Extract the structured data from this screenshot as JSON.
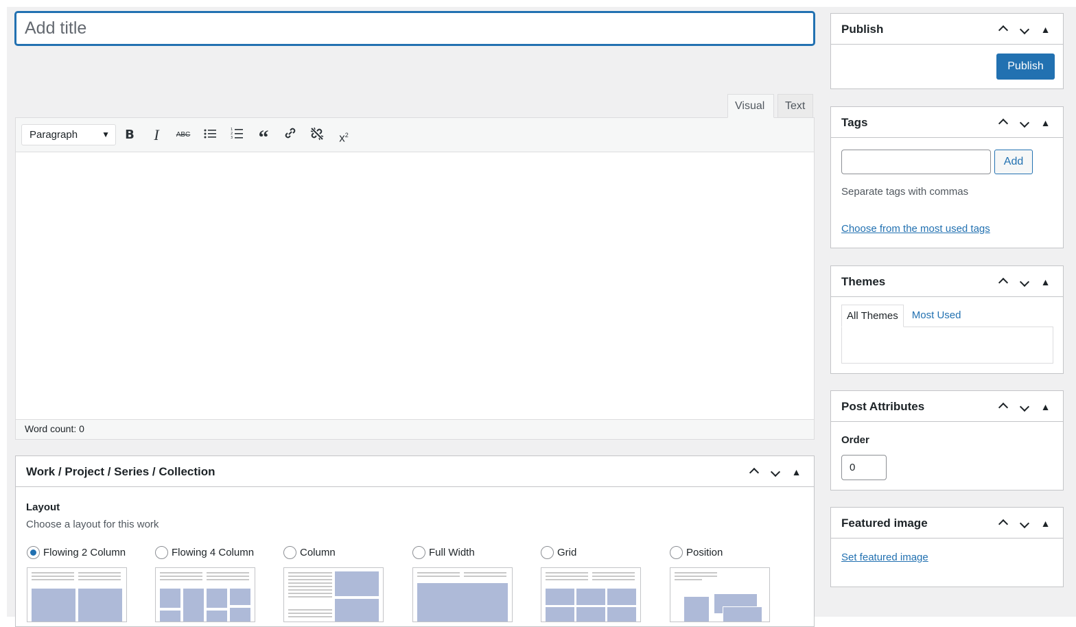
{
  "editor": {
    "title_placeholder": "Add title",
    "tabs": {
      "visual": "Visual",
      "text": "Text"
    },
    "format_select": "Paragraph",
    "toolbar_icons": [
      "bold-icon",
      "italic-icon",
      "strikethrough-icon",
      "bullet-list-icon",
      "numbered-list-icon",
      "blockquote-icon",
      "link-icon",
      "unlink-icon",
      "superscript-icon"
    ],
    "word_count": "Word count: 0"
  },
  "work_box": {
    "title": "Work / Project / Series / Collection",
    "layout_label": "Layout",
    "layout_desc": "Choose a layout for this work",
    "options": [
      {
        "label": "Flowing 2 Column",
        "checked": true
      },
      {
        "label": "Flowing 4 Column",
        "checked": false
      },
      {
        "label": "Column",
        "checked": false
      },
      {
        "label": "Full Width",
        "checked": false
      },
      {
        "label": "Grid",
        "checked": false
      },
      {
        "label": "Position",
        "checked": false
      }
    ]
  },
  "sidebar": {
    "publish": {
      "title": "Publish",
      "button": "Publish"
    },
    "tags": {
      "title": "Tags",
      "add_button": "Add",
      "hint": "Separate tags with commas",
      "link": "Choose from the most used tags"
    },
    "themes": {
      "title": "Themes",
      "tab_all": "All Themes",
      "tab_most": "Most Used"
    },
    "post_attributes": {
      "title": "Post Attributes",
      "order_label": "Order",
      "order_value": "0"
    },
    "featured_image": {
      "title": "Featured image",
      "link": "Set featured image"
    }
  },
  "colors": {
    "accent": "#2271b1",
    "background": "#f0f0f1",
    "thumb_block": "#aebad8"
  }
}
